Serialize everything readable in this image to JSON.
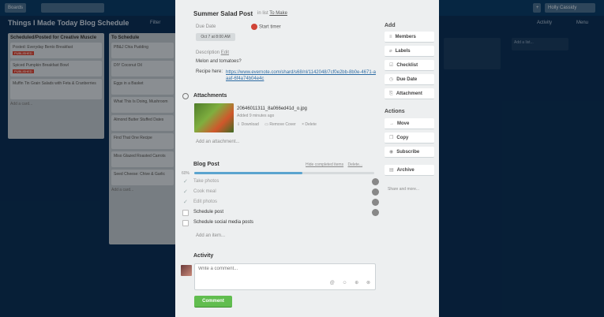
{
  "board": {
    "top_left_btn": "Boards",
    "title": "Things I Made Today Blog Schedule",
    "header_link": "Filter",
    "header_right": [
      "Activity",
      "Menu"
    ],
    "user": "Holly Cassidy",
    "lists": [
      {
        "title": "Scheduled/Posted for Creative Muscle",
        "cards": [
          "Posted: Everyday Bento Breakfast",
          "Spiced Pumpkin Breakfast Bowl",
          "Muffin Tin Grain Salads with Feta & Cranberries"
        ],
        "badge": "PUBLISHED",
        "add": "Add a card..."
      },
      {
        "title": "To Schedule",
        "cards": [
          "PB&J Chia Pudding",
          "DIY Coconut Oil",
          "Eggs in a Basket",
          "What This Is Doing, Mushroom",
          "Almond Butter Stuffed Dates",
          "Find That One Recipe",
          "Miso Glazed Roasted Carrots",
          "Seed Cheese: Chive & Garlic"
        ],
        "add": "Add a card..."
      }
    ],
    "right_lists": [
      "Add a list..."
    ]
  },
  "card": {
    "title": "Summer Salad Post",
    "in_list_prefix": "in list",
    "in_list_name": "To Make",
    "due_label": "Due Date",
    "due_value": "Oct 7 at 8:00 AM",
    "timer_label": "Start timer",
    "description_label": "Description",
    "description_edit": "Edit",
    "description_line1": "Melon and tomatoes?",
    "description_line2": "Recipe here:",
    "description_url": "https://www.evernote.com/shard/s68/nl/1142048/7cf0e2bb-8b0e-4671-aaaf-6f4a74b04e4c"
  },
  "attachments": {
    "heading": "Attachments",
    "file_name": "20646011311_8a066ed41d_o.jpg",
    "file_meta": "Added 9 minutes ago",
    "actions": [
      "Download",
      "Remove Cover",
      "Delete"
    ],
    "add_label": "Add an attachment..."
  },
  "checklist": {
    "heading": "Blog Post",
    "hide_label": "Hide completed items",
    "delete_label": "Delete...",
    "progress_pct": "60%",
    "progress_value": 0.6,
    "items": [
      {
        "text": "Take photos",
        "done": true
      },
      {
        "text": "Cook meal",
        "done": true
      },
      {
        "text": "Edit photos",
        "done": true
      },
      {
        "text": "Schedule post",
        "done": false
      },
      {
        "text": "Schedule social media posts",
        "done": false
      }
    ],
    "add_item": "Add an item..."
  },
  "activity": {
    "heading": "Activity",
    "comment_placeholder": "Write a comment...",
    "comment_tools": [
      "@",
      "☺",
      "⊕",
      "⊗"
    ],
    "comment_button": "Comment"
  },
  "sidebar": {
    "add_heading": "Add",
    "add_buttons": [
      {
        "icon": "≡",
        "label": "Members"
      },
      {
        "icon": "⌀",
        "label": "Labels"
      },
      {
        "icon": "☑",
        "label": "Checklist"
      },
      {
        "icon": "◷",
        "label": "Due Date"
      },
      {
        "icon": "⎘",
        "label": "Attachment"
      }
    ],
    "actions_heading": "Actions",
    "action_buttons": [
      {
        "icon": "→",
        "label": "Move"
      },
      {
        "icon": "❐",
        "label": "Copy"
      },
      {
        "icon": "◉",
        "label": "Subscribe"
      },
      {
        "icon": "▤",
        "label": "Archive"
      }
    ],
    "share_link": "Share and more..."
  },
  "colors": {
    "board_bg": "#0b2f55",
    "comment_button": "#61bd4f",
    "timer_dot": "#d04437",
    "progress": "#5ba4cf"
  }
}
